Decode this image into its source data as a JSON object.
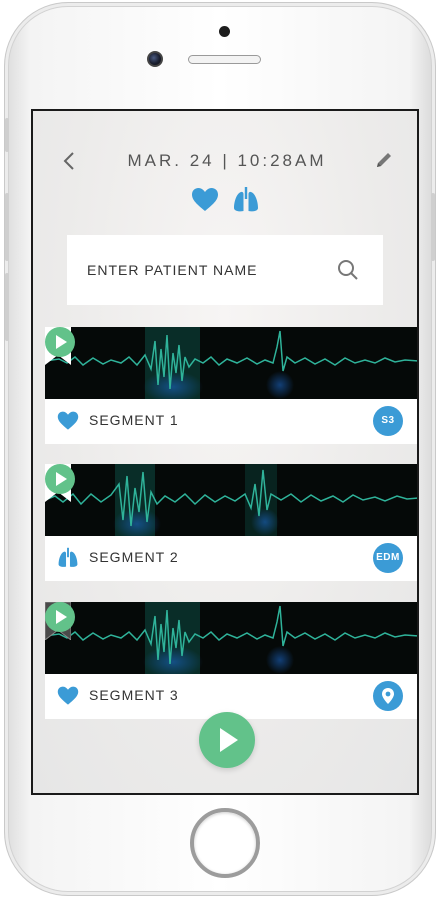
{
  "header": {
    "datetime": "MAR. 24  |  10:28AM"
  },
  "search": {
    "placeholder": "ENTER PATIENT NAME"
  },
  "segments": [
    {
      "label": "SEGMENT 1",
      "type_icon": "heart-icon",
      "bookmark": "white",
      "badge": "S3"
    },
    {
      "label": "SEGMENT 2",
      "type_icon": "lungs-icon",
      "bookmark": "white",
      "badge": "EDM"
    },
    {
      "label": "SEGMENT 3",
      "type_icon": "heart-icon",
      "bookmark": "dark",
      "badge_icon": "location-pin-icon"
    }
  ],
  "colors": {
    "accent_blue": "#3b9bd6",
    "play_green": "#62c28a",
    "waveform": "#2fb39a",
    "strip_background": "#050908"
  }
}
